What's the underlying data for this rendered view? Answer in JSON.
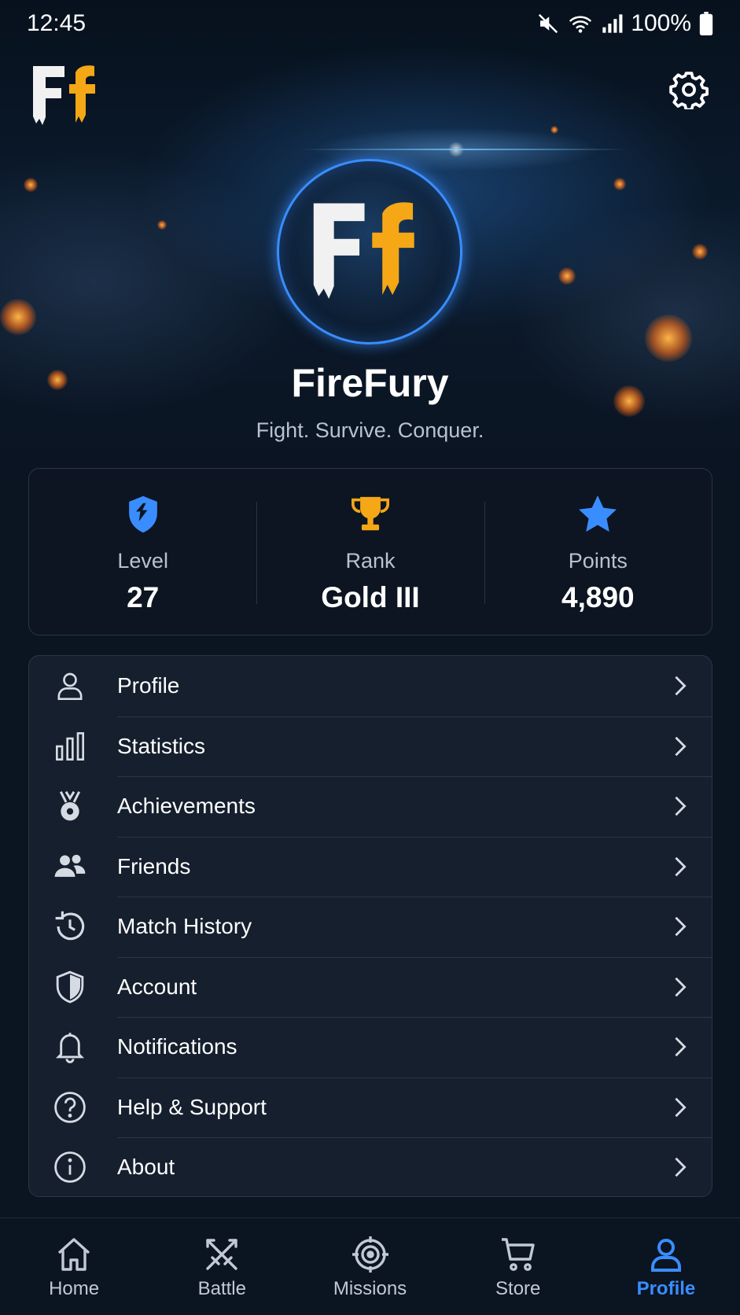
{
  "status_bar": {
    "time": "12:45",
    "battery": "100%"
  },
  "profile": {
    "username": "FireFury",
    "tagline": "Fight. Survive. Conquer."
  },
  "stats": [
    {
      "icon": "shield-level-icon",
      "label": "Level",
      "value": "27",
      "color": "#3a8dff"
    },
    {
      "icon": "trophy-icon",
      "label": "Rank",
      "value": "Gold III",
      "color": "#f5a716"
    },
    {
      "icon": "star-icon",
      "label": "Points",
      "value": "4,890",
      "color": "#3a8dff"
    }
  ],
  "menu": [
    {
      "icon": "person-icon",
      "label": "Profile"
    },
    {
      "icon": "bar-chart-icon",
      "label": "Statistics"
    },
    {
      "icon": "medal-icon",
      "label": "Achievements"
    },
    {
      "icon": "friends-icon",
      "label": "Friends"
    },
    {
      "icon": "history-icon",
      "label": "Match History"
    },
    {
      "icon": "shield-icon",
      "label": "Account"
    },
    {
      "icon": "bell-icon",
      "label": "Notifications"
    },
    {
      "icon": "help-icon",
      "label": "Help & Support"
    },
    {
      "icon": "info-icon",
      "label": "About"
    }
  ],
  "bottom_nav": [
    {
      "icon": "home-icon",
      "label": "Home",
      "active": false
    },
    {
      "icon": "swords-icon",
      "label": "Battle",
      "active": false
    },
    {
      "icon": "target-icon",
      "label": "Missions",
      "active": false
    },
    {
      "icon": "cart-icon",
      "label": "Store",
      "active": false
    },
    {
      "icon": "profile-icon",
      "label": "Profile",
      "active": true
    }
  ],
  "colors": {
    "accent": "#3a8dff",
    "gold": "#f5a716",
    "background": "#0b1421",
    "card": "#151f2d"
  }
}
